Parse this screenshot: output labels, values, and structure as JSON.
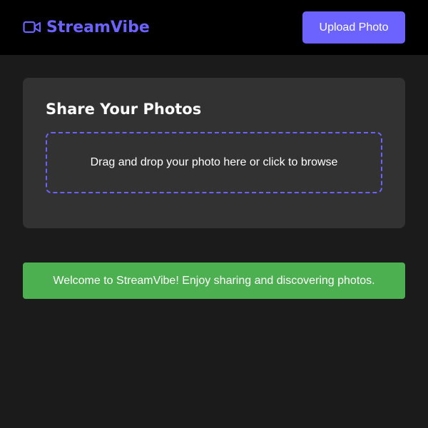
{
  "header": {
    "brand": {
      "icon": "video-camera-icon",
      "name": "StreamVibe"
    },
    "upload_button_label": "Upload Photo"
  },
  "upload_card": {
    "title": "Share Your Photos",
    "dropzone_text": "Drag and drop your photo here or click to browse"
  },
  "welcome_banner": {
    "message": "Welcome to StreamVibe! Enjoy sharing and discovering photos."
  },
  "colors": {
    "accent": "#6c63ff",
    "background": "#1b1b1b",
    "header": "#000000",
    "card": "#323232",
    "success": "#4caf50"
  }
}
